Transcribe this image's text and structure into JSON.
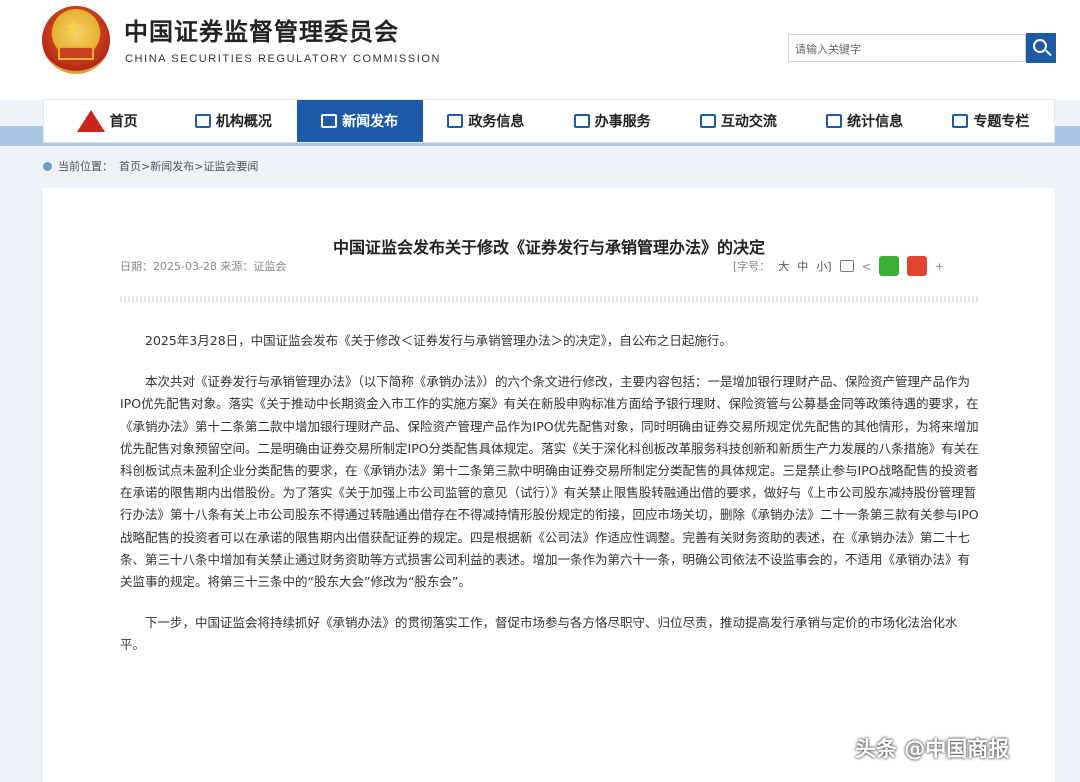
{
  "header": {
    "title": "中国证券监督管理委员会",
    "subtitle": "CHINA SECURITIES REGULATORY COMMISSION",
    "search_placeholder": "请输入关键字"
  },
  "nav": {
    "items": [
      {
        "label": "首页",
        "icon": "home-logo-icon"
      },
      {
        "label": "机构概况",
        "icon": "building-icon"
      },
      {
        "label": "新闻发布",
        "icon": "news-icon",
        "active": true
      },
      {
        "label": "政务信息",
        "icon": "monitor-icon"
      },
      {
        "label": "办事服务",
        "icon": "list-icon"
      },
      {
        "label": "互动交流",
        "icon": "chat-icon"
      },
      {
        "label": "统计信息",
        "icon": "bar-chart-icon"
      },
      {
        "label": "专题专栏",
        "icon": "document-icon"
      }
    ]
  },
  "breadcrumb": {
    "prefix": "当前位置：",
    "path": "首页>新闻发布>证监会要闻"
  },
  "article": {
    "title": "中国证监会发布关于修改《证券发行与承销管理办法》的决定",
    "meta": "日期：2025-03-28 来源：证监会",
    "font_label": "[字号：",
    "size_large": "大",
    "size_medium": "中",
    "size_small": "小]",
    "paragraphs": [
      "2025年3月28日，中国证监会发布《关于修改＜证券发行与承销管理办法＞的决定》，自公布之日起施行。",
      "本次共对《证券发行与承销管理办法》（以下简称《承销办法》）的六个条文进行修改，主要内容包括：一是增加银行理财产品、保险资产管理产品作为IPO优先配售对象。落实《关于推动中长期资金入市工作的实施方案》有关在新股申购标准方面给予银行理财、保险资管与公募基金同等政策待遇的要求，在《承销办法》第十二条第二款中增加银行理财产品、保险资产管理产品作为IPO优先配售对象，同时明确由证券交易所规定优先配售的其他情形，为将来增加优先配售对象预留空间。二是明确由证券交易所制定IPO分类配售具体规定。落实《关于深化科创板改革服务科技创新和新质生产力发展的八条措施》有关在科创板试点未盈利企业分类配售的要求，在《承销办法》第十二条第三款中明确由证券交易所制定分类配售的具体规定。三是禁止参与IPO战略配售的投资者在承诺的限售期内出借股份。为了落实《关于加强上市公司监管的意见（试行）》有关禁止限售股转融通出借的要求，做好与《上市公司股东减持股份管理暂行办法》第十八条有关上市公司股东不得通过转融通出借存在不得减持情形股份规定的衔接，回应市场关切，删除《承销办法》二十一条第三款有关参与IPO战略配售的投资者可以在承诺的限售期内出借获配证券的规定。四是根据新《公司法》作适应性调整。完善有关财务资助的表述，在《承销办法》第二十七条、第三十八条中增加有关禁止通过财务资助等方式损害公司利益的表述。增加一条作为第六十一条，明确公司依法不设监事会的，不适用《承销办法》有关监事的规定。将第三十三条中的“股东大会”修改为“股东会”。",
      "下一步，中国证监会将持续抓好《承销办法》的贯彻落实工作，督促市场参与各方恪尽职守、归位尽责，推动提高发行承销与定价的市场化法治化水平。"
    ]
  },
  "watermark": "头条 @中国商报",
  "colors": {
    "primary": "#1d5aa8",
    "band": "#a9c6e3",
    "emblem_red": "#c8401f"
  }
}
